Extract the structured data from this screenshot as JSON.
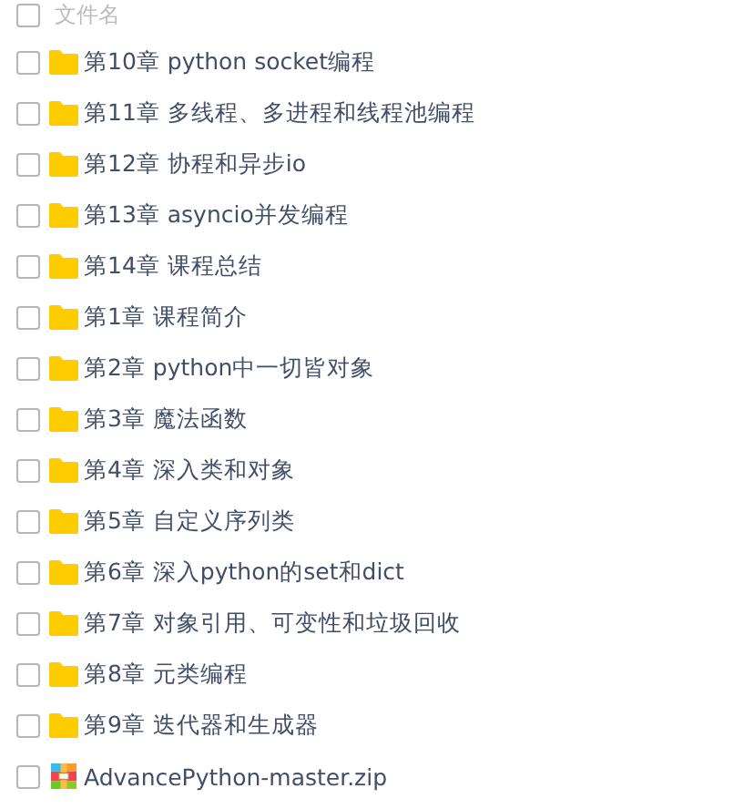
{
  "header": {
    "checked": false,
    "label": "文件名"
  },
  "files": [
    {
      "name": "第10章 python socket编程",
      "kind": "folder",
      "checked": false
    },
    {
      "name": "第11章 多线程、多进程和线程池编程",
      "kind": "folder",
      "checked": false
    },
    {
      "name": "第12章 协程和异步io",
      "kind": "folder",
      "checked": false
    },
    {
      "name": "第13章 asyncio并发编程",
      "kind": "folder",
      "checked": false
    },
    {
      "name": "第14章 课程总结",
      "kind": "folder",
      "checked": false
    },
    {
      "name": "第1章 课程简介",
      "kind": "folder",
      "checked": false
    },
    {
      "name": "第2章 python中一切皆对象",
      "kind": "folder",
      "checked": false
    },
    {
      "name": "第3章 魔法函数",
      "kind": "folder",
      "checked": false
    },
    {
      "name": "第4章 深入类和对象",
      "kind": "folder",
      "checked": false
    },
    {
      "name": "第5章 自定义序列类",
      "kind": "folder",
      "checked": false
    },
    {
      "name": "第6章 深入python的set和dict",
      "kind": "folder",
      "checked": false
    },
    {
      "name": "第7章 对象引用、可变性和垃圾回收",
      "kind": "folder",
      "checked": false
    },
    {
      "name": "第8章 元类编程",
      "kind": "folder",
      "checked": false
    },
    {
      "name": "第9章 迭代器和生成器",
      "kind": "folder",
      "checked": false
    },
    {
      "name": "AdvancePython-master.zip",
      "kind": "zip",
      "checked": false
    }
  ]
}
